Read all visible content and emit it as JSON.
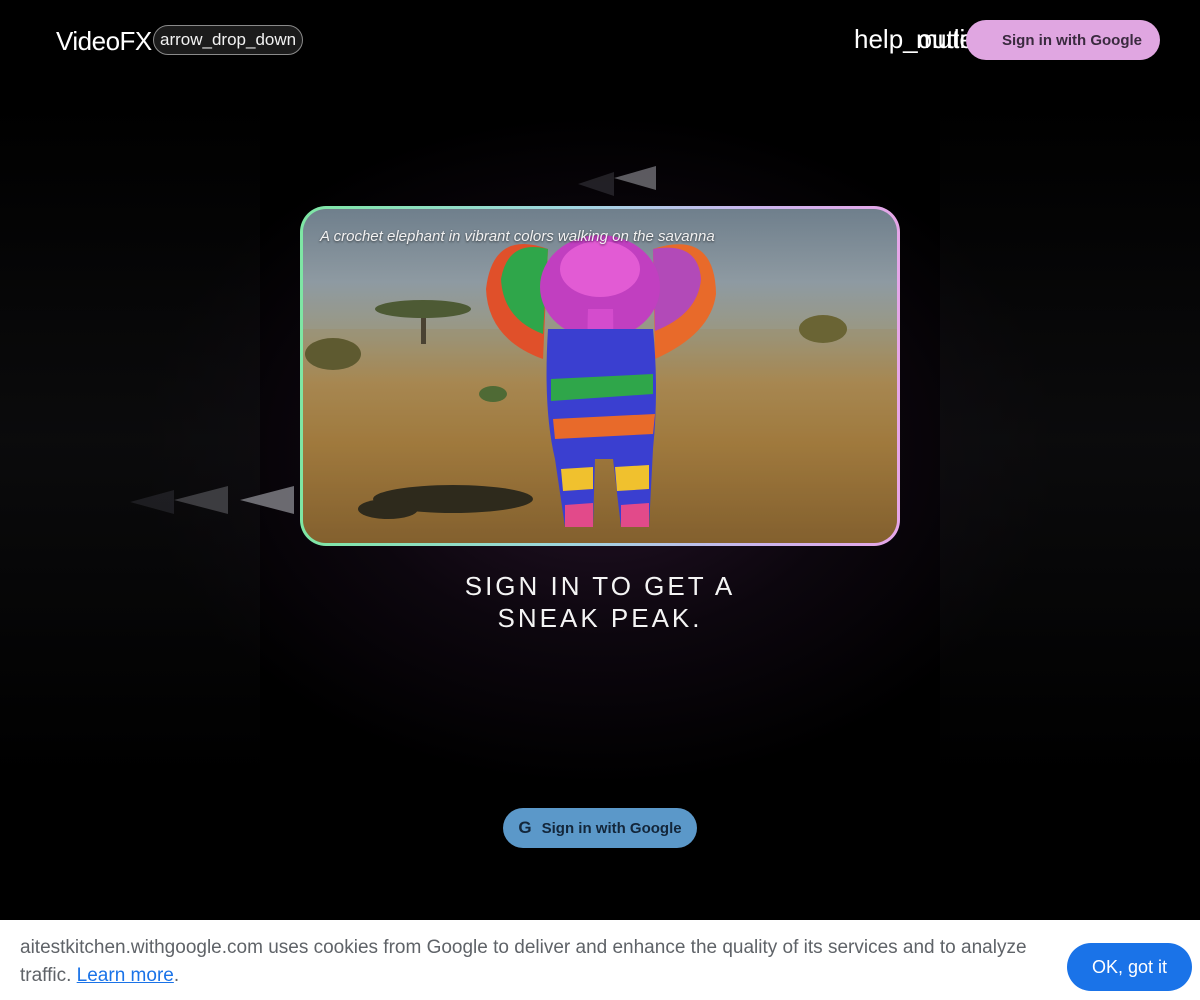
{
  "header": {
    "brand": "VideoFX",
    "product_switch_label": "arrow_drop_down",
    "icon_help": "help_outline",
    "icon_mute": "mute",
    "icon_alert": "alert",
    "signin_label": "Sign in with Google"
  },
  "showcase": {
    "caption": "A crochet elephant in vibrant colors walking on the savanna"
  },
  "headline": {
    "line1": "SIGN IN TO GET A",
    "line2": "SNEAK PEAK."
  },
  "main_signin": {
    "icon": "G",
    "label": "Sign in with Google"
  },
  "cookie": {
    "text": "aitestkitchen.withgoogle.com uses cookies from Google to deliver and enhance the quality of its services and to analyze traffic.",
    "link_text": "Learn more",
    "period": ".",
    "ok_label": "OK, got it"
  },
  "colors": {
    "background": "#000000",
    "header_signin": "#e0a6e1",
    "main_signin": "#5b98c9",
    "cookie_button": "#1a73e8"
  }
}
